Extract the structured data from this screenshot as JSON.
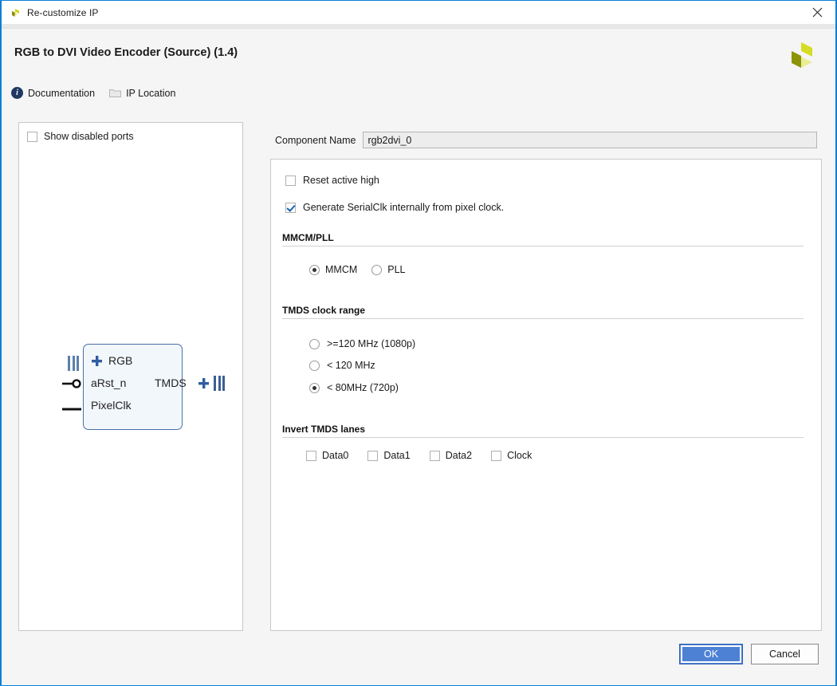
{
  "window": {
    "title": "Re-customize IP",
    "close_label": "✕",
    "accent_color": "#0a80d4"
  },
  "header": {
    "page_title": "RGB to DVI Video Encoder (Source) (1.4)",
    "logo_name": "xilinx-logo",
    "links": [
      {
        "label": "Documentation",
        "icon": "info-icon"
      },
      {
        "label": "IP Location",
        "icon": "folder-icon"
      }
    ]
  },
  "left_panel": {
    "show_disabled_ports": {
      "label": "Show disabled ports",
      "checked": false
    },
    "symbol": {
      "inputs": [
        {
          "label": "RGB",
          "type": "bus",
          "expander": "+"
        },
        {
          "label": "aRst_n",
          "type": "active-low"
        },
        {
          "label": "PixelClk",
          "type": "clock"
        }
      ],
      "outputs": [
        {
          "label": "TMDS",
          "type": "bus",
          "expander": "+"
        }
      ]
    }
  },
  "settings": {
    "component_name": {
      "label": "Component Name",
      "value": "rgb2dvi_0",
      "placeholder": "rgb2dvi_0"
    },
    "checkboxes": [
      {
        "label": "Reset active high",
        "checked": false
      },
      {
        "label": "Generate SerialClk internally from pixel clock.",
        "checked": true
      }
    ],
    "mmcm_pll": {
      "header": "MMCM/PLL",
      "options": [
        {
          "label": "MMCM",
          "selected": true
        },
        {
          "label": "PLL",
          "selected": false
        }
      ]
    },
    "tmds_clock_range": {
      "header": "TMDS clock range",
      "options": [
        {
          "label": ">=120 MHz (1080p)",
          "selected": false
        },
        {
          "label": "< 120 MHz",
          "selected": false
        },
        {
          "label": "< 80MHz (720p)",
          "selected": true
        }
      ]
    },
    "invert_tmds_lanes": {
      "header": "Invert TMDS lanes",
      "options": [
        {
          "label": "Data0",
          "checked": false
        },
        {
          "label": "Data1",
          "checked": false
        },
        {
          "label": "Data2",
          "checked": false
        },
        {
          "label": "Clock",
          "checked": false
        }
      ]
    }
  },
  "footer": {
    "ok_label": "OK",
    "cancel_label": "Cancel"
  }
}
